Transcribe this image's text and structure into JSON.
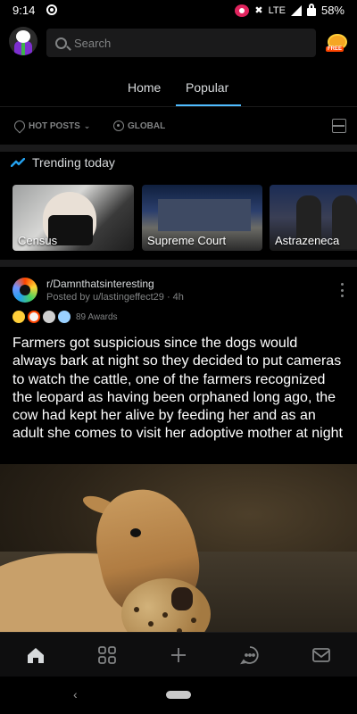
{
  "status_bar": {
    "time": "9:14",
    "network": "LTE",
    "battery": "58%"
  },
  "header": {
    "search_placeholder": "Search",
    "coins_badge": "FREE"
  },
  "tabs": [
    {
      "label": "Home",
      "active": false
    },
    {
      "label": "Popular",
      "active": true
    }
  ],
  "filters": {
    "sort": "HOT POSTS",
    "location": "GLOBAL"
  },
  "trending": {
    "heading": "Trending today",
    "cards": [
      {
        "label": "Census"
      },
      {
        "label": "Supreme Court"
      },
      {
        "label": "Astrazeneca"
      }
    ]
  },
  "post": {
    "subreddit": "r/Damnthatsinteresting",
    "posted_by": "Posted by u/lastingeffect29 · 4h",
    "awards": "89 Awards",
    "title": "Farmers got suspicious since the dogs would always bark at night so they decided to put cameras to watch the cattle, one of the farmers recognized the leopard as having been orphaned long ago, the cow had kept her alive by feeding her and as an adult she comes to visit her adoptive mother at night"
  },
  "colors": {
    "background": "#000000",
    "accent": "#4fbcff",
    "text": "#d7dadc",
    "muted": "#818384"
  },
  "bottom_nav": {
    "items": [
      "home-icon",
      "communities-icon",
      "create-icon",
      "chat-icon",
      "inbox-icon"
    ]
  }
}
